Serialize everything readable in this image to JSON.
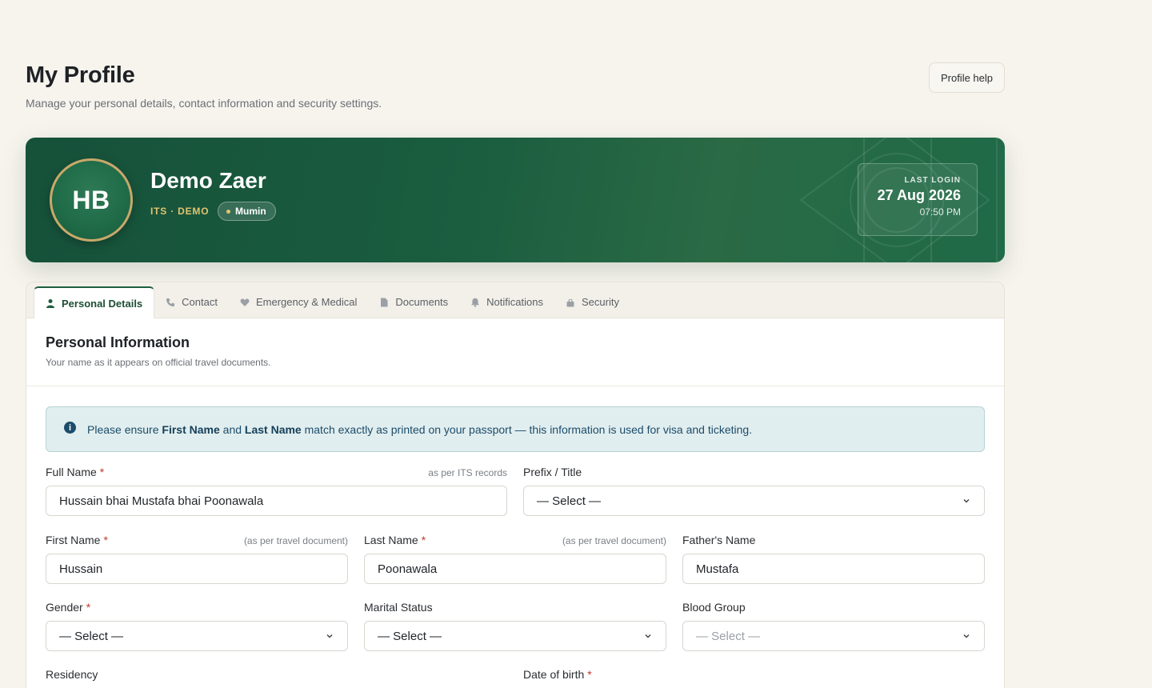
{
  "header": {
    "title": "My Profile",
    "subtitle": "Manage your personal details, contact information and security settings.",
    "help_label": "Profile help"
  },
  "banner": {
    "initials": "HB",
    "name": "Demo Zaer",
    "its_label": "ITS · DEMO",
    "role": "Mumin",
    "last_login_label": "LAST LOGIN",
    "last_login_date": "27 Aug 2026",
    "last_login_time": "07:50 PM"
  },
  "tabs": [
    {
      "label": "Personal Details",
      "icon": "person-icon",
      "active": true
    },
    {
      "label": "Contact",
      "icon": "phone-icon",
      "active": false
    },
    {
      "label": "Emergency & Medical",
      "icon": "heart-icon",
      "active": false
    },
    {
      "label": "Documents",
      "icon": "document-icon",
      "active": false
    },
    {
      "label": "Notifications",
      "icon": "bell-icon",
      "active": false
    },
    {
      "label": "Security",
      "icon": "lock-icon",
      "active": false
    }
  ],
  "section": {
    "title": "Personal Information",
    "subtitle": "Your name as it appears on official travel documents."
  },
  "alert": {
    "prefix": "Please ensure ",
    "bold1": "First Name",
    "mid": " and ",
    "bold2": "Last Name",
    "suffix": " match exactly as printed on your passport — this information is used for visa and ticketing."
  },
  "fields": {
    "full_name": {
      "label": "Full Name",
      "hint": "as per ITS records",
      "value": "Hussain bhai Mustafa bhai Poonawala"
    },
    "prefix": {
      "label": "Prefix / Title",
      "value": "— Select —"
    },
    "first_name": {
      "label": "First Name",
      "hint": "(as per travel document)",
      "value": "Hussain"
    },
    "last_name": {
      "label": "Last Name",
      "hint": "(as per travel document)",
      "value": "Poonawala"
    },
    "father_name": {
      "label": "Father's Name",
      "value": "Mustafa"
    },
    "gender": {
      "label": "Gender",
      "value": "— Select —"
    },
    "marital_status": {
      "label": "Marital Status",
      "value": "— Select —"
    },
    "blood_group": {
      "label": "Blood Group",
      "value": "— Select —"
    },
    "residency": {
      "label": "Residency"
    },
    "dob": {
      "label": "Date of birth"
    }
  },
  "colors": {
    "brand_green": "#1a5d3f",
    "gold": "#e3c46f",
    "required": "#c0392b"
  }
}
